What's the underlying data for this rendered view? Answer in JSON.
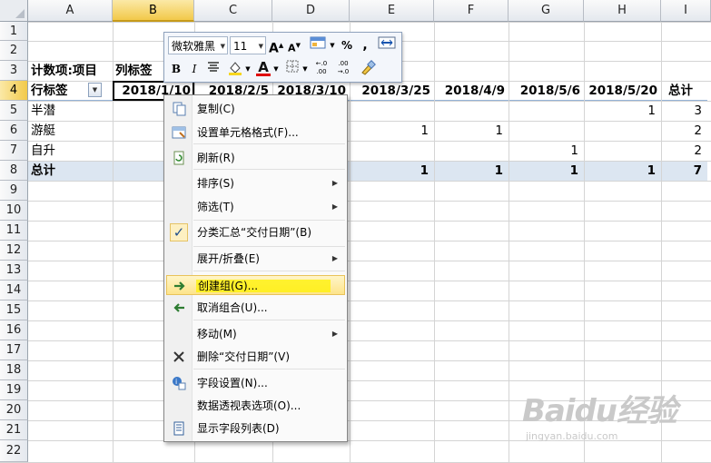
{
  "columns": [
    "A",
    "B",
    "C",
    "D",
    "E",
    "F",
    "G",
    "H",
    "I"
  ],
  "rows": [
    "1",
    "2",
    "3",
    "4",
    "5",
    "6",
    "7",
    "8",
    "9",
    "10",
    "11",
    "12",
    "13",
    "14",
    "15",
    "16",
    "17",
    "18",
    "19",
    "20",
    "21",
    "22"
  ],
  "selected_column": "B",
  "selected_row": "4",
  "pivot": {
    "row3_a": "计数项:项目",
    "row3_b": "列标签",
    "row4_a": "行标签",
    "dates": [
      "2018/1/10",
      "2018/2/5",
      "2018/3/10",
      "2018/3/25",
      "2018/4/9",
      "2018/5/6",
      "2018/5/20"
    ],
    "total_header": "总计",
    "rows": [
      {
        "label": "半潜",
        "values": [
          "",
          "",
          "",
          "",
          "",
          "",
          "1"
        ],
        "total": "3"
      },
      {
        "label": "游艇",
        "values": [
          "",
          "",
          "",
          "1",
          "1",
          "",
          ""
        ],
        "total": "2"
      },
      {
        "label": "自升",
        "values": [
          "",
          "",
          "",
          "",
          "",
          "1",
          ""
        ],
        "total": "2"
      },
      {
        "label": "总计",
        "values": [
          "",
          "",
          "",
          "1",
          "1",
          "1",
          "1"
        ],
        "total": "7"
      }
    ]
  },
  "mini_toolbar": {
    "font_name": "微软雅黑",
    "font_size": "11",
    "grow_font": "A",
    "shrink_font": "A",
    "percent": "%",
    "comma": ",",
    "bold": "B",
    "italic": "I",
    "font_color_letter": "A",
    "inc_decimal": "+.0 .00",
    "dec_decimal": ".00 →.0"
  },
  "context_menu": [
    {
      "label": "复制(C)",
      "icon": "copy-icon"
    },
    {
      "label": "设置单元格格式(F)...",
      "icon": "format-cells-icon"
    },
    {
      "label": "刷新(R)",
      "icon": "refresh-icon"
    },
    {
      "label": "排序(S)",
      "submenu": true
    },
    {
      "label": "筛选(T)",
      "submenu": true
    },
    {
      "label": "分类汇总“交付日期”(B)",
      "checked": true
    },
    {
      "label": "展开/折叠(E)",
      "submenu": true
    },
    {
      "label": "创建组(G)...",
      "icon": "group-icon",
      "highlighted": true
    },
    {
      "label": "取消组合(U)...",
      "icon": "ungroup-icon"
    },
    {
      "label": "移动(M)",
      "submenu": true
    },
    {
      "label": "删除“交付日期”(V)",
      "icon": "delete-icon"
    },
    {
      "label": "字段设置(N)...",
      "icon": "field-settings-icon"
    },
    {
      "label": "数据透视表选项(O)...",
      "icon": ""
    },
    {
      "label": "显示字段列表(D)",
      "icon": "field-list-icon"
    }
  ],
  "watermark": {
    "logo": "Baidu经验",
    "url": "jingyan.baidu.com"
  },
  "colors": {
    "band": "#dce6f1",
    "highlight": "#fff200",
    "selected_header": "#f2c94a"
  }
}
